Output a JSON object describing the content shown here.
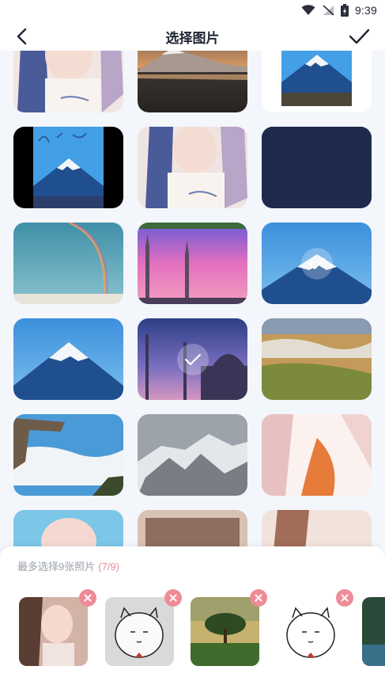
{
  "status_bar": {
    "time": "9:39",
    "icons": [
      "wifi-icon",
      "signal-off-icon",
      "battery-icon"
    ]
  },
  "header": {
    "title": "选择图片",
    "back_icon": "back-arrow-icon",
    "confirm_icon": "checkmark-icon"
  },
  "grid": {
    "photos": [
      {
        "subject": "girl-portrait",
        "selected": false
      },
      {
        "subject": "mountain-sunset-lake",
        "selected": false
      },
      {
        "subject": "fuji-sketch",
        "selected": false
      },
      {
        "subject": "fuji-sketch-dark",
        "selected": false
      },
      {
        "subject": "girl-portrait",
        "selected": false
      },
      {
        "subject": "navy-blank",
        "selected": false
      },
      {
        "subject": "rainbow-sky",
        "selected": false
      },
      {
        "subject": "minarets-pink-sky",
        "selected": false
      },
      {
        "subject": "mount-fuji",
        "selected": true
      },
      {
        "subject": "mount-fuji",
        "selected": false
      },
      {
        "subject": "mosque-dusk",
        "selected": true
      },
      {
        "subject": "valley-fog",
        "selected": false
      },
      {
        "subject": "cliff-clouds",
        "selected": false
      },
      {
        "subject": "snowy-mountains",
        "selected": false
      },
      {
        "subject": "anime-girl",
        "selected": false
      },
      {
        "subject": "anime-girl-2",
        "selected": false
      },
      {
        "subject": "anime-girl-3",
        "selected": false
      },
      {
        "subject": "anime-girl-4",
        "selected": false
      }
    ]
  },
  "selection_panel": {
    "hint": "最多选择9张照片",
    "count": "(7/9)",
    "selected": [
      {
        "subject": "woman-portrait"
      },
      {
        "subject": "cartoon-cat"
      },
      {
        "subject": "tree-landscape"
      },
      {
        "subject": "cartoon-cat"
      },
      {
        "subject": "forest-partial"
      }
    ]
  },
  "colors": {
    "accent_pink": "#e88a98",
    "remove_badge": "#ee8b97",
    "background": "#f3f6fb",
    "navy": "#1f2b4d"
  }
}
